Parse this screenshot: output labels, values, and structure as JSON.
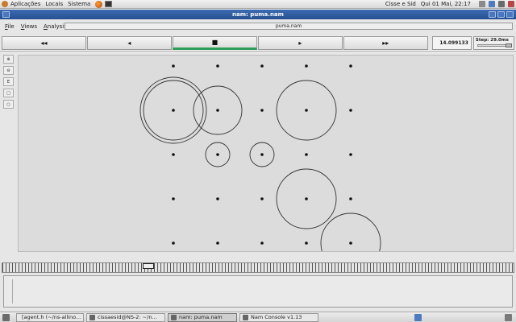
{
  "top_panel": {
    "menus": [
      "Aplicações",
      "Locais",
      "Sistema"
    ],
    "user": "Cisse e Sid",
    "clock": "Qui 01 Mai, 22:17"
  },
  "window": {
    "title": "nam: puma.nam"
  },
  "menu_bar": {
    "items": [
      "File",
      "Views",
      "Analysis"
    ],
    "file_label": "puma.nam"
  },
  "playback": {
    "rewind": "◂◂",
    "back": "◂",
    "stop": "■",
    "play": "▸",
    "forward": "▸▸",
    "time": "14.099133",
    "step_label": "Step: 29.0ms"
  },
  "tools": [
    "zoom-in",
    "zoom-out",
    "edit",
    "node",
    "link"
  ],
  "network": {
    "grid_cols": 5,
    "grid_rows": 5,
    "nodes_present_note": "",
    "ranges": [
      {
        "col": 0,
        "row": 1,
        "r": "large-double"
      },
      {
        "col": 1,
        "row": 1,
        "r": "medium"
      },
      {
        "col": 3,
        "row": 1,
        "r": "large"
      },
      {
        "col": 1,
        "row": 2,
        "r": "small"
      },
      {
        "col": 2,
        "row": 2,
        "r": "small"
      },
      {
        "col": 3,
        "row": 3,
        "r": "large"
      },
      {
        "col": 4,
        "row": 4,
        "r": "large"
      }
    ]
  },
  "taskbar": {
    "tasks": [
      "[agent.h (~/ns-allino...",
      "cissaesid@NS-2: ~/n...",
      "nam: puma.nam",
      "Nam Console v1.13"
    ]
  },
  "colors": {
    "title_bar": "#2f5da3",
    "active_indicator": "#2f9e5a",
    "canvas": "#dcdcdc"
  }
}
